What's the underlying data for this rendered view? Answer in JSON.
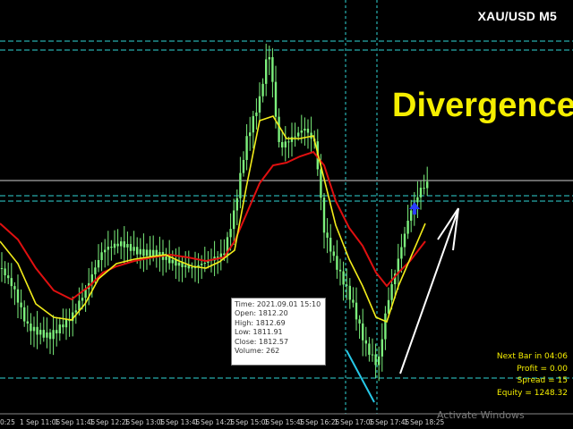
{
  "symbol": "XAU/USD M5",
  "headline": "Divergence",
  "tooltip": {
    "time": "Time: 2021.09.01 15:10",
    "open": "Open: 1812.20",
    "high": "High: 1812.69",
    "low": "Low: 1811.91",
    "close": "Close: 1812.57",
    "volume": "Volume: 262"
  },
  "stats": {
    "next_bar": "Next Bar in 04:06",
    "profit": "Profit = 0.00",
    "spread": "Spread = 15",
    "equity": "Equity = 1248.32"
  },
  "x_ticks": [
    "0:25",
    "1 Sep 11:05",
    "1 Sep 11:45",
    "1 Sep 12:25",
    "1 Sep 13:05",
    "1 Sep 13:45",
    "1 Sep 14:25",
    "1 Sep 15:05",
    "1 Sep 15:45",
    "1 Sep 16:25",
    "1 Sep 17:05",
    "1 Sep 17:45",
    "1 Sep 18:25"
  ],
  "watermark": "Activate Windows",
  "colors": {
    "background": "#000000",
    "bull_candle": "#7cf07c",
    "bear_candle": "#7cf07c",
    "fast_ma": "#f2ec1a",
    "slow_ma": "#e01010",
    "level_line": "#2fd6d6",
    "grid_line": "#d0d0d0",
    "headline": "#f5ee00",
    "price_line": "#cfcfcf",
    "divergence_price": "#27c9e8",
    "divergence_indicator": "#ffffff",
    "signal_arrow": "#2a3cff"
  },
  "chart_data": {
    "type": "candlestick",
    "symbol": "XAU/USD",
    "timeframe": "M5",
    "indicators": [
      "fast moving average (yellow)",
      "slow moving average (red)"
    ],
    "annotation": "Divergence",
    "x_tick_labels": [
      "0:25",
      "1 Sep 11:05",
      "1 Sep 11:45",
      "1 Sep 12:25",
      "1 Sep 13:05",
      "1 Sep 13:45",
      "1 Sep 14:25",
      "1 Sep 15:05",
      "1 Sep 15:45",
      "1 Sep 16:25",
      "1 Sep 17:05",
      "1 Sep 17:45",
      "1 Sep 18:25"
    ]
  }
}
